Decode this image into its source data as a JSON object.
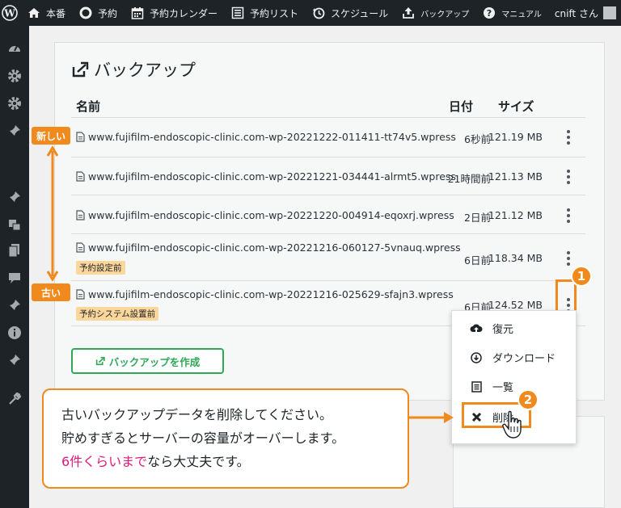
{
  "adminbar": {
    "items": [
      {
        "label": "本番",
        "icon": "home-icon"
      },
      {
        "label": "予約",
        "icon": "circle-icon"
      },
      {
        "label": "予約カレンダー",
        "icon": "calendar-icon"
      },
      {
        "label": "予約リスト",
        "icon": "list-icon"
      },
      {
        "label": "スケジュール",
        "icon": "clock-icon"
      }
    ],
    "backup_label": "バックアップ",
    "manual_label": "マニュアル",
    "user_label": "cnift さん"
  },
  "page": {
    "title": "バックアップ",
    "columns": {
      "name": "名前",
      "date": "日付",
      "size": "サイズ"
    },
    "rows": [
      {
        "file": "www.fujifilm-endoscopic-clinic.com-wp-20221222-011411-tt74v5.wpress",
        "date": "6秒前",
        "size": "121.19 MB",
        "tag": ""
      },
      {
        "file": "www.fujifilm-endoscopic-clinic.com-wp-20221221-034441-alrmt5.wpress",
        "date": "21時間前",
        "size": "121.13 MB",
        "tag": ""
      },
      {
        "file": "www.fujifilm-endoscopic-clinic.com-wp-20221220-004914-eqoxrj.wpress",
        "date": "2日前",
        "size": "121.12 MB",
        "tag": ""
      },
      {
        "file": "www.fujifilm-endoscopic-clinic.com-wp-20221216-060127-5vnauq.wpress",
        "date": "6日前",
        "size": "118.34 MB",
        "tag": "予約設定前"
      },
      {
        "file": "www.fujifilm-endoscopic-clinic.com-wp-20221216-025629-sfajn3.wpress",
        "date": "6日前",
        "size": "124.52 MB",
        "tag": "予約システム設置前"
      }
    ],
    "create_button": "バックアップを作成"
  },
  "menu": {
    "restore": "復元",
    "download": "ダウンロード",
    "list": "一覧",
    "delete": "削除"
  },
  "annotations": {
    "newest": "新しい",
    "oldest": "古い",
    "badge1": "1",
    "badge2": "2",
    "note_line1": "古いバックアップデータを削除してください。",
    "note_line2": "貯めすぎるとサーバーの容量がオーバーします。",
    "note_line3_highlight": "6件くらいまで",
    "note_line3_rest": "なら大丈夫です。"
  },
  "colors": {
    "accent": "#f08a1c",
    "green": "#2ea857",
    "pink": "#e0187a",
    "tag": "#fcd79b"
  }
}
